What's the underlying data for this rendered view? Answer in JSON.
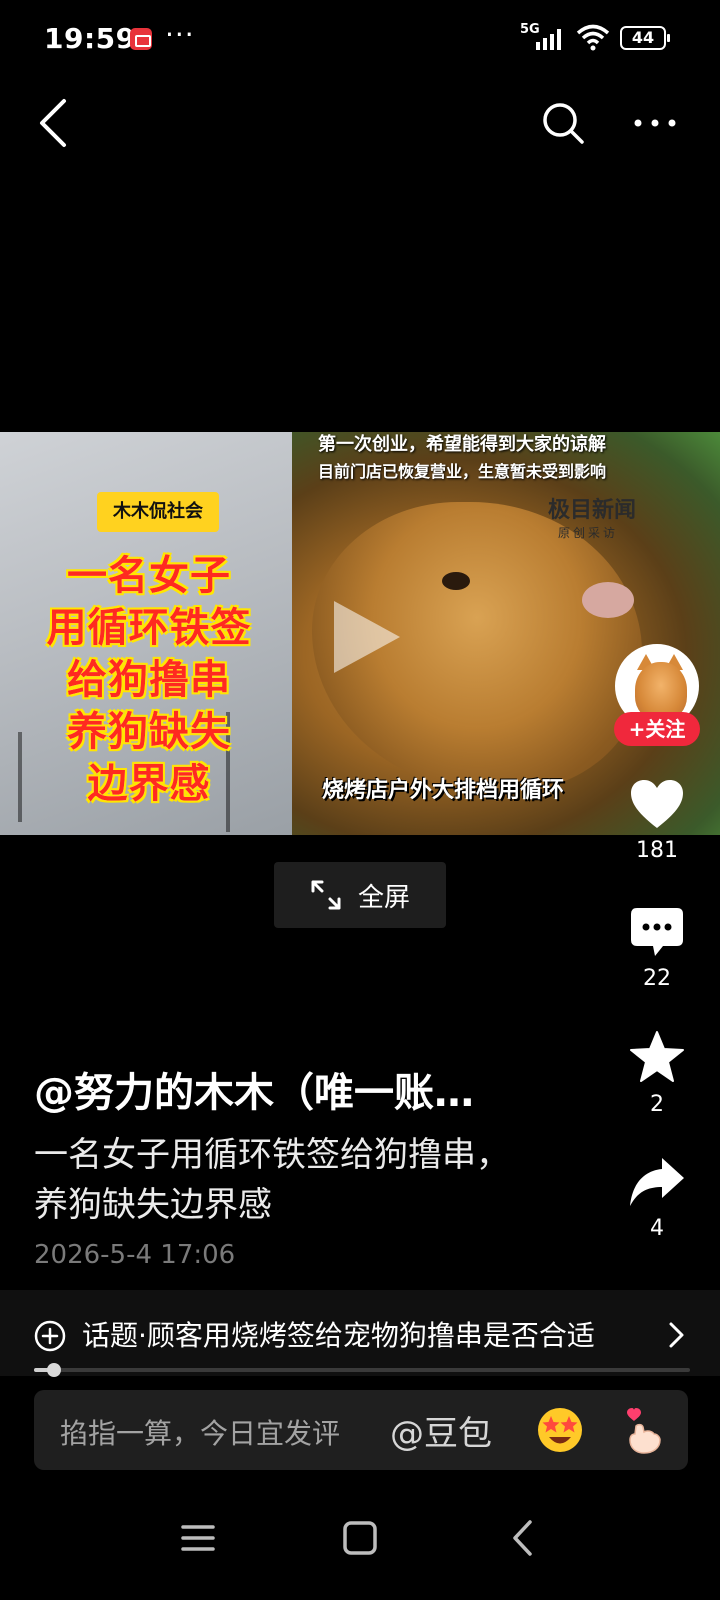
{
  "status_bar": {
    "time": "19:59",
    "dots": "···",
    "network": "5G",
    "battery": "44"
  },
  "video": {
    "channel_badge": "木木侃社会",
    "title_lines": [
      "一名女子",
      "用循环铁签",
      "给狗撸串",
      "养狗缺失",
      "边界感"
    ],
    "news_top_line": "第一次创业，希望能得到大家的谅解",
    "news_sub_line": "目前门店已恢复营业，生意暂未受到影响",
    "news_logo": "极目新闻",
    "news_logo_sub": "原创采访",
    "subtitle": "烧烤店户外大排档用循环"
  },
  "fullscreen": {
    "label": "全屏"
  },
  "follow": {
    "label": "+关注"
  },
  "actions": {
    "likes": "181",
    "comments": "22",
    "favorites": "2",
    "shares": "4"
  },
  "post": {
    "author": "@努力的木木（唯一账…",
    "text": "一名女子用循环铁签给狗撸串，养狗缺失边界感",
    "time": "2026-5-4 17:06"
  },
  "topic": {
    "text": "话题·顾客用烧烤签给宠物狗撸串是否合适"
  },
  "progress": {
    "fraction": 0.03
  },
  "comment_input": {
    "placeholder": "掐指一算，今日宜发评",
    "mention": "@豆包"
  },
  "icons": {
    "back": "back-arrow-icon",
    "search": "search-icon",
    "more": "more-icon",
    "like": "heart-icon",
    "comment": "comment-icon",
    "favorite": "star-icon",
    "share": "share-icon"
  }
}
